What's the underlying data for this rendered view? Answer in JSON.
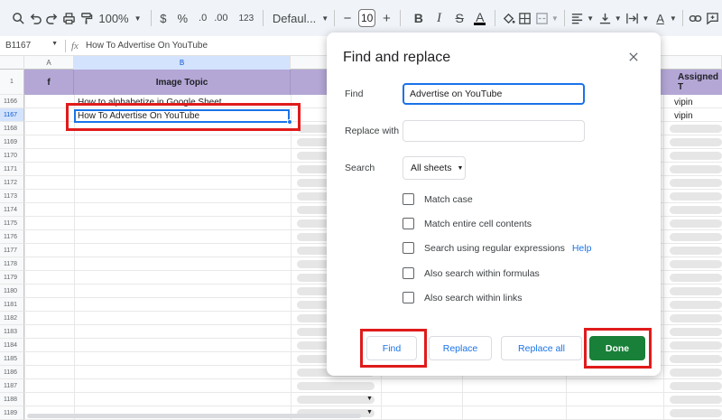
{
  "toolbar": {
    "zoom": "100%",
    "currency": "$",
    "percent": "%",
    "decrease_decimal": ".0",
    "increase_decimal": ".00",
    "number_format": "123",
    "font_family": "Defaul...",
    "font_size": "10",
    "minus": "−",
    "plus": "+",
    "bold": "B",
    "italic": "I",
    "strike": "S",
    "text_color": "A"
  },
  "formula_bar": {
    "name_box": "B1167",
    "fx": "fx",
    "content": "How To Advertise On YouTube"
  },
  "sheet": {
    "columns": [
      "A",
      "B"
    ],
    "header": {
      "col_a": "f",
      "col_b": "Image Topic",
      "col_c_partial": "P",
      "col_right_partial": "Assigned T"
    },
    "header_row_number": "1",
    "row_numbers": [
      "1166",
      "1167",
      "1168",
      "1169",
      "1170",
      "1171",
      "1172",
      "1173",
      "1174",
      "1175",
      "1176",
      "1177",
      "1178",
      "1179",
      "1180",
      "1181",
      "1182",
      "1183",
      "1184",
      "1185",
      "1186",
      "1187",
      "1188",
      "1189"
    ],
    "cells": {
      "b1166": "How to alphabetize in Google Sheet",
      "b1167": "How To Advertise On YouTube",
      "assigned_1166": "vipin",
      "assigned_1167": "vipin"
    }
  },
  "dialog": {
    "title": "Find and replace",
    "find_label": "Find",
    "find_value": "Advertise on YouTube",
    "replace_label": "Replace with",
    "replace_value": "",
    "search_label": "Search",
    "search_scope": "All sheets",
    "options": [
      "Match case",
      "Match entire cell contents",
      "Search using regular expressions",
      "Also search within formulas",
      "Also search within links"
    ],
    "help_link": "Help",
    "buttons": {
      "find": "Find",
      "replace": "Replace",
      "replace_all": "Replace all",
      "done": "Done"
    }
  },
  "colors": {
    "header_fill": "#b4a7d6",
    "accent_blue": "#1a73e8",
    "done_green": "#188038",
    "highlight_red": "#e01b1b"
  }
}
